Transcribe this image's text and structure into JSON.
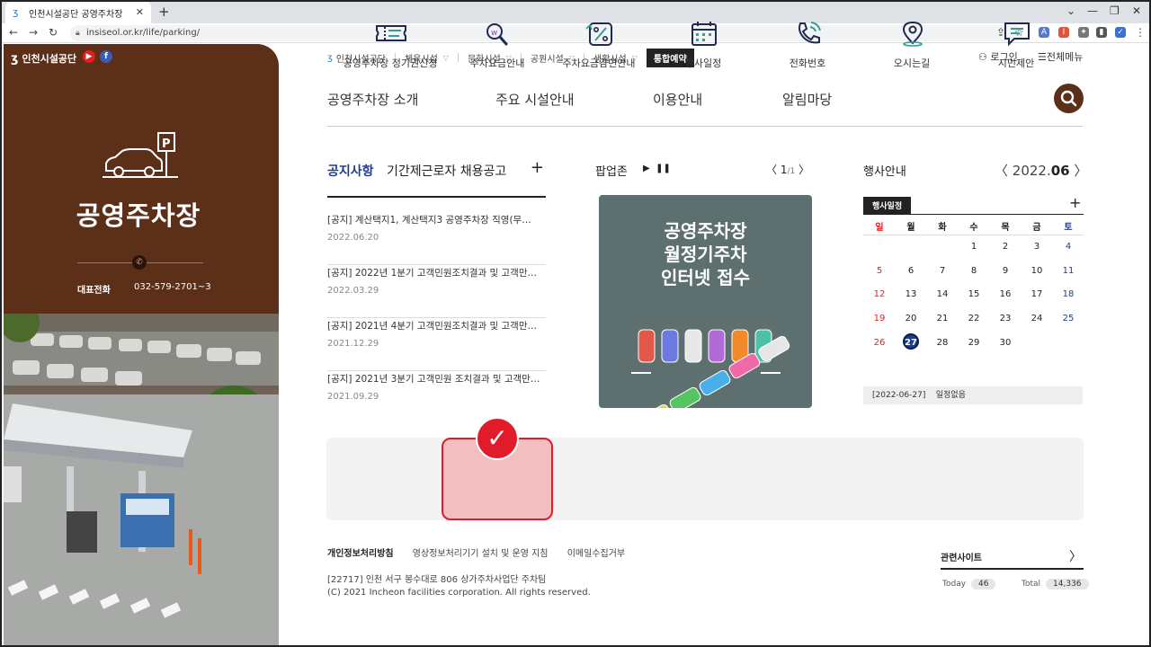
{
  "browser": {
    "tab_title": "인천시설공단 공영주차장",
    "url": "insiseol.or.kr/life/parking/"
  },
  "hero": {
    "brand": "인천시설공단",
    "title": "공영주차장",
    "phone_label": "대표전화",
    "phone_number": "032-579-2701~3"
  },
  "topnav": {
    "items": [
      "인천시설공단",
      "체육시설",
      "문화시설",
      "공원시설",
      "생활시설"
    ],
    "reserve": "통합예약",
    "login": "로그인",
    "all_menu": "전체메뉴"
  },
  "gnb": {
    "items": [
      "공영주차장 소개",
      "주요 시설안내",
      "이용안내",
      "알림마당"
    ]
  },
  "notice": {
    "tab_active": "공지사항",
    "tab_other": "기간제근로자 채용공고",
    "items": [
      {
        "title": "[공지] 계산택지1, 계산택지3 공영주차장 직영(무…",
        "date": "2022.06.20"
      },
      {
        "title": "[공지] 2022년 1분기 고객민원조치결과 및 고객만…",
        "date": "2022.03.29"
      },
      {
        "title": "[공지] 2021년 4분기 고객민원조치결과 및 고객만…",
        "date": "2021.12.29"
      },
      {
        "title": "[공지] 2021년 3분기 고객민원 조치결과 및 고객만…",
        "date": "2021.09.29"
      }
    ]
  },
  "popup": {
    "title": "팝업존",
    "page": "1",
    "total": "/1",
    "banner_lines": [
      "공영주차장",
      "월정기주차",
      "인터넷 접수"
    ]
  },
  "events": {
    "title": "행사안내",
    "year": "2022.",
    "month": "06",
    "tab": "행사일정",
    "weekdays": [
      "일",
      "월",
      "화",
      "수",
      "목",
      "금",
      "토"
    ],
    "days": [
      "1",
      "2",
      "3",
      "4",
      "5",
      "6",
      "7",
      "8",
      "9",
      "10",
      "11",
      "12",
      "13",
      "14",
      "15",
      "16",
      "17",
      "18",
      "19",
      "20",
      "21",
      "22",
      "23",
      "24",
      "25",
      "26",
      "27",
      "28",
      "29",
      "30"
    ],
    "today": "27",
    "info_date": "[2022-06-27]",
    "info_text": "일정없음",
    "colors": {
      "sunday": "#e02020",
      "saturday": "#1d3e8a",
      "today": "#1d3e8a"
    }
  },
  "quick": {
    "items": [
      "공영주차장 정기권신청",
      "주차요금안내",
      "주차요금감면안내",
      "행사일정",
      "전화번호",
      "오시는길",
      "시민제안"
    ],
    "highlight_mark": "✓"
  },
  "footer": {
    "links": [
      "개인정보처리방침",
      "영상정보처리기기 설치 및 운영 지침",
      "이메일수집거부"
    ],
    "address": "[22717] 인천 서구 봉수대로 806 상가주차사업단 주차팀",
    "copyright": "(C) 2021 Incheon facilities corporation. All rights reserved.",
    "related": "관련사이트",
    "today_label": "Today",
    "today_count": "46",
    "total_label": "Total",
    "total_count": "14,336"
  },
  "theme": {
    "brown": "#5c2f19",
    "highlight": "#e21b2a"
  }
}
